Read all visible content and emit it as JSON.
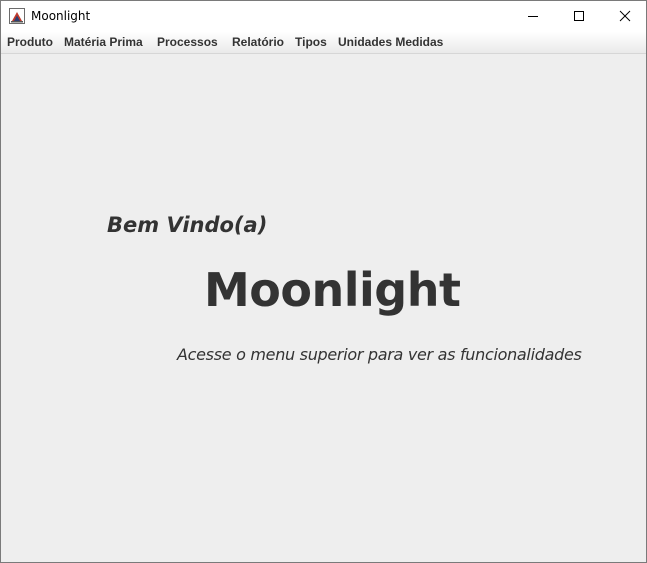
{
  "window": {
    "title": "Moonlight",
    "icon": "java-app-icon"
  },
  "title_buttons": {
    "minimize_icon": "minimize-icon",
    "maximize_icon": "maximize-icon",
    "close_icon": "close-icon"
  },
  "menubar": {
    "items": [
      {
        "label": "Produto"
      },
      {
        "label": "Matéria Prima"
      },
      {
        "label": "Processos"
      },
      {
        "label": "Relatório"
      },
      {
        "label": "Tipos"
      },
      {
        "label": "Unidades Medidas"
      }
    ]
  },
  "main": {
    "welcome": "Bem Vindo(a)",
    "app_name": "Moonlight",
    "subtitle": "Acesse o menu superior para ver as funcionalidades"
  },
  "colors": {
    "background": "#eeeeee",
    "text": "#333333",
    "titlebar": "#ffffff"
  }
}
